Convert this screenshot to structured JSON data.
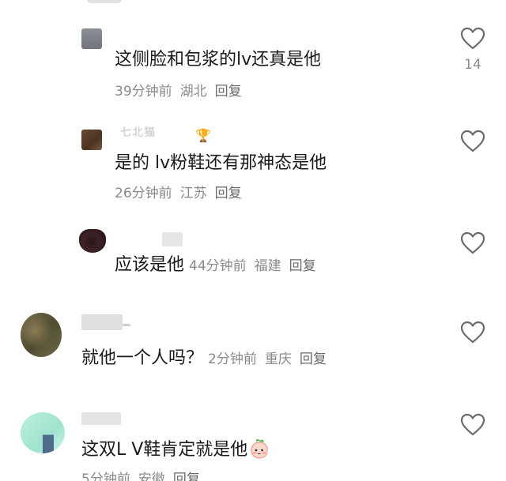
{
  "comments": [
    {
      "name": "",
      "content": "这侧脸和包浆的lv还真是他",
      "time": "39分钟前",
      "location": "湖北",
      "reply_label": "回复",
      "like_count": "14"
    },
    {
      "name": "七北猫",
      "content": "是的 lv粉鞋还有那神态是他",
      "time": "26分钟前",
      "location": "江苏",
      "reply_label": "回复",
      "like_count": ""
    },
    {
      "name": "",
      "content": "应该是他",
      "time": "44分钟前",
      "location": "福建",
      "reply_label": "回复",
      "like_count": ""
    },
    {
      "name": "",
      "content": "就他一个人吗？",
      "time": "2分钟前",
      "location": "重庆",
      "reply_label": "回复",
      "like_count": ""
    },
    {
      "name": "",
      "content": "这双L V鞋肯定就是他",
      "time": "5分钟前",
      "location": "安徽",
      "reply_label": "回复",
      "like_count": ""
    }
  ],
  "icons": {
    "like": "heart-outline-icon",
    "emoji": "peach-face-emoji",
    "name_badge": "trophy-icon"
  },
  "colors": {
    "text": "#1a1a1a",
    "meta": "#8a8a8a",
    "heart_stroke": "#6a6a6a"
  }
}
